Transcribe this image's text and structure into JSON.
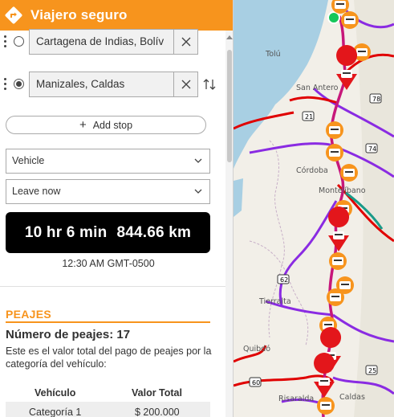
{
  "app": {
    "title": "Viajero seguro"
  },
  "stops": [
    {
      "value": "Cartagena de Indias, Bolív",
      "radio": "empty"
    },
    {
      "value": "Manizales, Caldas",
      "radio": "filled"
    }
  ],
  "icons": {
    "app": "route-arrow-icon",
    "clear": "close-icon",
    "swap": "swap-vertical-icon",
    "drag": "drag-handle-icon",
    "chevron": "chevron-down-icon",
    "add": "plus-icon",
    "toll": "toll-booth-icon"
  },
  "add_stop": {
    "label": "Add stop",
    "icon": "+"
  },
  "mode": {
    "value": "Vehicle"
  },
  "time": {
    "value": "Leave now"
  },
  "summary": {
    "duration": "10 hr 6 min",
    "distance": "844.66 km"
  },
  "arrival": {
    "text": "12:30 AM GMT-0500"
  },
  "peajes": {
    "title": "PEAJES",
    "count_label": "Número de peajes: 17",
    "description": "Este es el valor total del pago de peajes por la categoría del vehículo:",
    "headers": [
      "Vehículo",
      "Valor Total"
    ],
    "rows": [
      [
        "Categoría 1",
        "$ 200.000"
      ]
    ]
  },
  "map": {
    "labels": [
      "San Antero",
      "Córdoba",
      "Montelíbano",
      "Tierralta",
      "Quibdó",
      "Risaralda",
      "Caldas",
      "Tolú"
    ],
    "shields": [
      "21",
      "74",
      "78",
      "62",
      "60",
      "25"
    ],
    "colors": {
      "accent": "#f7941d",
      "route": "#c7177a",
      "toll_red": "#e3161b",
      "road_purple": "#8a2be2",
      "road_red": "#e00000",
      "water": "#a8cfe3"
    }
  }
}
